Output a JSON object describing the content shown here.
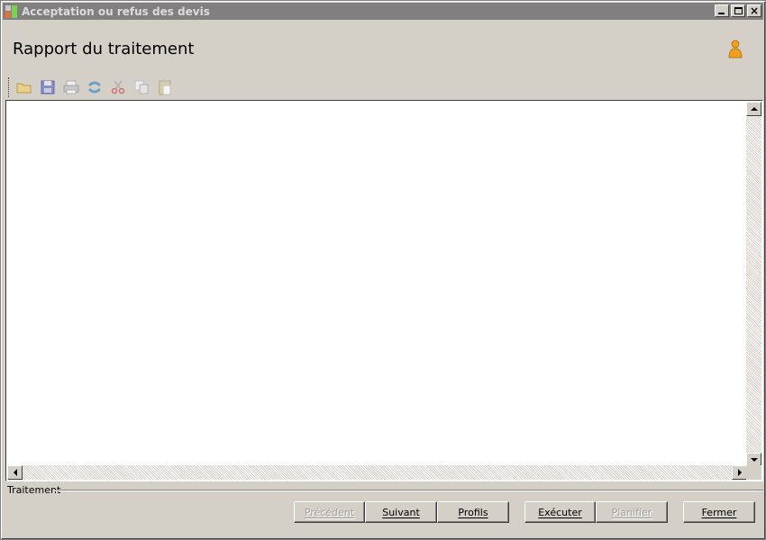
{
  "window": {
    "title": "Acceptation ou refus des devis",
    "controls": {
      "minimize": "minimize-icon",
      "maximize": "maximize-icon",
      "close": "×"
    }
  },
  "header": {
    "title": "Rapport du traitement",
    "user_icon": "user-icon"
  },
  "toolbar": {
    "items": [
      "open-folder-icon",
      "save-icon",
      "print-icon",
      "refresh-icon",
      "cut-icon",
      "copy-icon",
      "paste-icon"
    ]
  },
  "report": {
    "content": ""
  },
  "status": {
    "label": "Traitement"
  },
  "buttons": {
    "precedent": "Précédent",
    "suivant": "Suivant",
    "profils": "Profils",
    "executer": "Exécuter",
    "planifier": "Planifier",
    "fermer": "Fermer"
  },
  "colors": {
    "titlebar": "#808080",
    "face": "#d4d0c8",
    "content": "#ffffff",
    "accent_user": "#f0a020"
  }
}
